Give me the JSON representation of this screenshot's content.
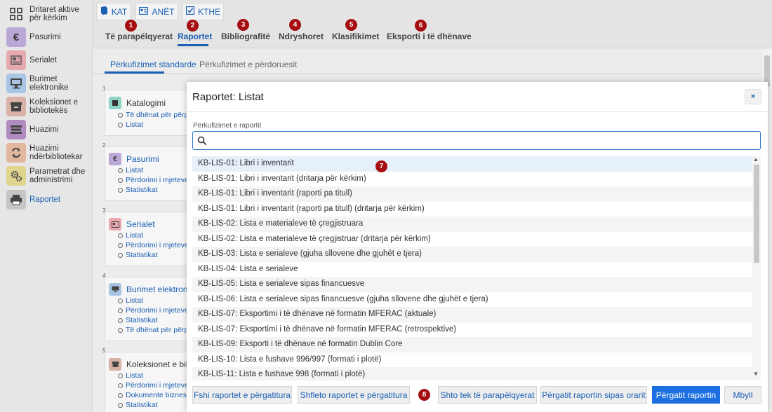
{
  "sidebar": {
    "items": [
      {
        "label": "Dritaret aktive për kërkim",
        "icon": "grid-icon",
        "color": "#e6e6e6"
      },
      {
        "label": "Pasurimi",
        "icon": "euro-icon",
        "color": "#b9a8d6"
      },
      {
        "label": "Serialet",
        "icon": "newspaper-icon",
        "color": "#e8a9ae"
      },
      {
        "label": "Burimet elektronike",
        "icon": "monitor-icon",
        "color": "#a9c5e6"
      },
      {
        "label": "Koleksionet e bibliotekës",
        "icon": "archive-icon",
        "color": "#d9b2a7"
      },
      {
        "label": "Huazimi",
        "icon": "books-icon",
        "color": "#b28cc1"
      },
      {
        "label": "Huazimi ndërbibliotekar",
        "icon": "exchange-icon",
        "color": "#e3b79d"
      },
      {
        "label": "Parametrat dhe administrimi",
        "icon": "gears-icon",
        "color": "#dfd58f"
      },
      {
        "label": "Raportet",
        "icon": "printer-icon",
        "color": "#c5c5c5"
      }
    ]
  },
  "toolbar": {
    "buttons": [
      {
        "label": "KAT",
        "icon": "book-icon"
      },
      {
        "label": "ANËT",
        "icon": "id-card-icon"
      },
      {
        "label": "KTHE",
        "icon": "check-box-icon"
      }
    ]
  },
  "tabs": [
    {
      "label": "Të parapëlqyerat"
    },
    {
      "label": "Raportet"
    },
    {
      "label": "Bibliografitë"
    },
    {
      "label": "Ndryshoret"
    },
    {
      "label": "Klasifikimet"
    },
    {
      "label": "Eksporti i të dhënave"
    }
  ],
  "subtabs": [
    {
      "label": "Përkufizimet standarde"
    },
    {
      "label": "Përkufizimet e përdoruesit"
    }
  ],
  "cards": [
    {
      "num": "1",
      "title": "Katalogimi",
      "links": [
        "Të dhënat për përpu",
        "Listat"
      ]
    },
    {
      "num": "2",
      "title": "Pasurimi",
      "links": [
        "Listat",
        "Përdorimi i mjeteve",
        "Statistikat"
      ]
    },
    {
      "num": "3",
      "title": "Serialet",
      "links": [
        "Listat",
        "Përdorimi i mjeteve",
        "Statistikat"
      ]
    },
    {
      "num": "4",
      "title": "Burimet elektronike",
      "links": [
        "Listat",
        "Përdorimi i mjeteve",
        "Statistikat",
        "Të dhënat për përpu"
      ]
    },
    {
      "num": "5",
      "title": "Koleksionet e bibli",
      "links": [
        "Listat",
        "Përdorimi i mjeteve",
        "Dokumente biznesi",
        "Statistikat"
      ]
    }
  ],
  "modal": {
    "title": "Raportet: Listat",
    "close_label": "×",
    "search_label": "Përkufizimet e raportit",
    "search_value": "",
    "items": [
      "KB-LIS-01: Libri i inventarit",
      "KB-LIS-01: Libri i inventarit (dritarja për kërkim)",
      "KB-LIS-01: Libri i inventarit (raporti pa titull)",
      "KB-LIS-01: Libri i inventarit (raporti pa titull) (dritarja për kërkim)",
      "KB-LIS-02: Lista e materialeve të çregjistruara",
      "KB-LIS-02: Lista e materialeve të çregjistruar (dritarja për kërkim)",
      "KB-LIS-03: Lista e serialeve (gjuha sllovene dhe gjuhët e tjera)",
      "KB-LIS-04: Lista e serialeve",
      "KB-LIS-05: Lista e serialeve sipas financuesve",
      "KB-LIS-06: Lista e serialeve sipas financuesve (gjuha sllovene dhe gjuhët e tjera)",
      "KB-LIS-07: Eksportimi i të dhënave në formatin MFERAC (aktuale)",
      "KB-LIS-07: Eksportimi i të dhënave në formatin MFERAC (retrospektive)",
      "KB-LIS-09: Eksporti i të dhënave në formatin Dublin Core",
      "KB-LIS-10: Lista e fushave 996/997 (formati i plotë)",
      "KB-LIS-11: Lista e fushave 998 (formati i plotë)"
    ],
    "footer_buttons": [
      "Fshi raportet e përgatitura",
      "Shfleto raportet e përgatitura",
      "Shto tek të parapëlqyerat",
      "Përgatit raportin sipas orarit",
      "Përgatit raportin",
      "Mbyll"
    ]
  },
  "markers": [
    "1",
    "2",
    "3",
    "4",
    "5",
    "6",
    "7",
    "8"
  ],
  "colors": {
    "accent": "#1a5fb4",
    "primary_button": "#1b6fe0",
    "marker": "#a50d10"
  }
}
